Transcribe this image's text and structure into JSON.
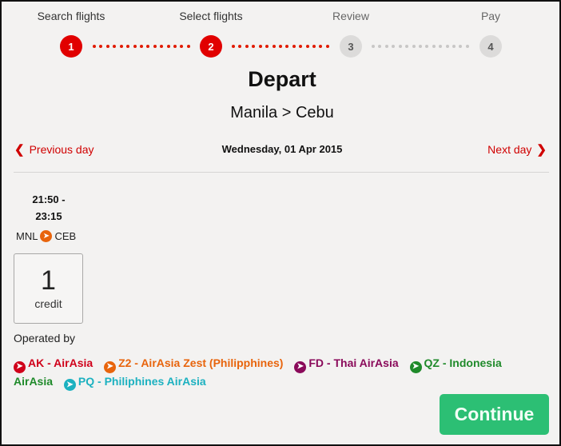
{
  "stepper": {
    "steps": [
      {
        "number": "1",
        "label": "Search flights",
        "state": "done"
      },
      {
        "number": "2",
        "label": "Select flights",
        "state": "done"
      },
      {
        "number": "3",
        "label": "Review",
        "state": "todo"
      },
      {
        "number": "4",
        "label": "Pay",
        "state": "todo"
      }
    ]
  },
  "header": {
    "title": "Depart",
    "route": "Manila > Cebu"
  },
  "day_nav": {
    "previous_label": "Previous day",
    "next_label": "Next day",
    "current_date": "Wednesday, 01 Apr 2015",
    "prev_icon": "chevron-left-icon",
    "next_icon": "chevron-right-icon"
  },
  "flight": {
    "time_depart": "21:50 -",
    "time_arrive": "23:15",
    "origin": "MNL",
    "destination": "CEB",
    "route_icon": "plane-icon",
    "fare_amount": "1",
    "fare_unit": "credit"
  },
  "operated_by": {
    "label": "Operated by",
    "carriers": [
      {
        "code_name": "AK - AirAsia",
        "color": "#d0001a"
      },
      {
        "code_name": "Z2 - AirAsia Zest (Philipphines)",
        "color": "#e8640c"
      },
      {
        "code_name": "FD - Thai AirAsia",
        "color": "#8a0a5a"
      },
      {
        "code_name": "QZ - Indonesia AirAsia",
        "color": "#1f8a2a"
      },
      {
        "code_name": "PQ - Philiphines AirAsia",
        "color": "#1cb1c0"
      }
    ]
  },
  "actions": {
    "continue_label": "Continue",
    "continue_color": "#2cbf74"
  },
  "colors": {
    "accent_red": "#e10000",
    "inactive_grey": "#dcdbda"
  }
}
